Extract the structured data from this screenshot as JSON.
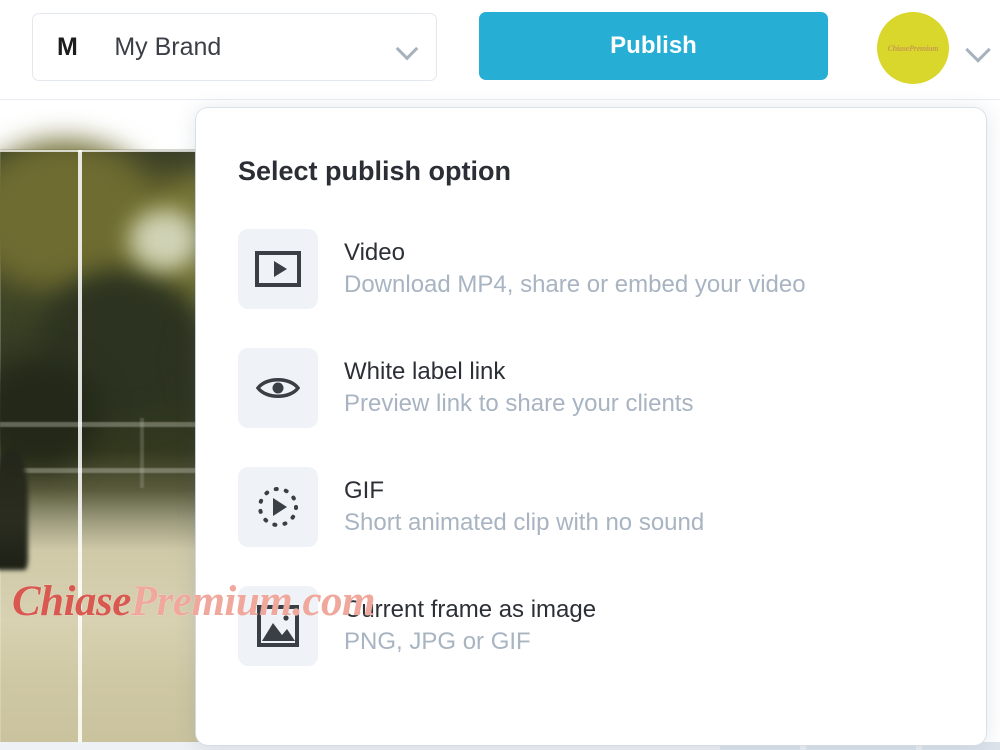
{
  "topbar": {
    "brand_selector": {
      "initial": "M",
      "name": "My Brand",
      "chevron_icon": "chevron-down-icon"
    },
    "publish_button": {
      "label": "Publish",
      "color": "#26aed5"
    },
    "account": {
      "avatar_text": "ChiasePremium",
      "avatar_color": "#d9d72b",
      "chevron_icon": "chevron-down-icon"
    }
  },
  "panel": {
    "title": "Select publish option",
    "options": [
      {
        "icon": "video-frame-play-icon",
        "title": "Video",
        "subtitle": "Download MP4, share or embed your video"
      },
      {
        "icon": "eye-icon",
        "title": "White label link",
        "subtitle": "Preview link to share your clients"
      },
      {
        "icon": "dashed-circle-play-icon",
        "title": "GIF",
        "subtitle": "Short animated clip with no sound"
      },
      {
        "icon": "image-mountain-icon",
        "title": "Current frame as image",
        "subtitle": "PNG, JPG or GIF"
      }
    ]
  },
  "watermark": {
    "part1": "Chiase",
    "part2": "Premium.com"
  }
}
